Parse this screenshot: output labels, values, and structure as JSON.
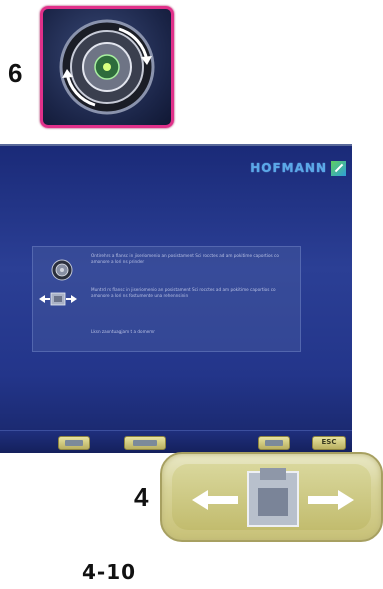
{
  "callouts": {
    "top_number": "6",
    "bottom_number": "4"
  },
  "screen": {
    "logo_text": "HOFMANN",
    "dialog": {
      "message_1": "Ontirehrs a flansc in jiseriomenio an posistament Sci rocctes ad am pokitime caportios co amonore a lori ns prinder",
      "message_2": "Muntrd rs flansc in jiseriomenio an posistament Sci rocctes ad am pokitime caportios co amonore a lori ns fostumente una rehennsinin",
      "message_3": "Lksn zaxntuagjam t a domemr"
    },
    "toolbar": {
      "button_4_label": "ESC"
    }
  },
  "page_number": "4-10",
  "icons": {
    "top": "wheel-rotate-icon",
    "dialog_1": "wheel-icon",
    "dialog_2": "wheel-shift-icon",
    "bottom": "wheel-shift-icon"
  },
  "colors": {
    "highlight_border": "#e0308a",
    "screen_background": "#23358a",
    "logo": "#5aa8e8",
    "button_face": "#d8d49a"
  }
}
